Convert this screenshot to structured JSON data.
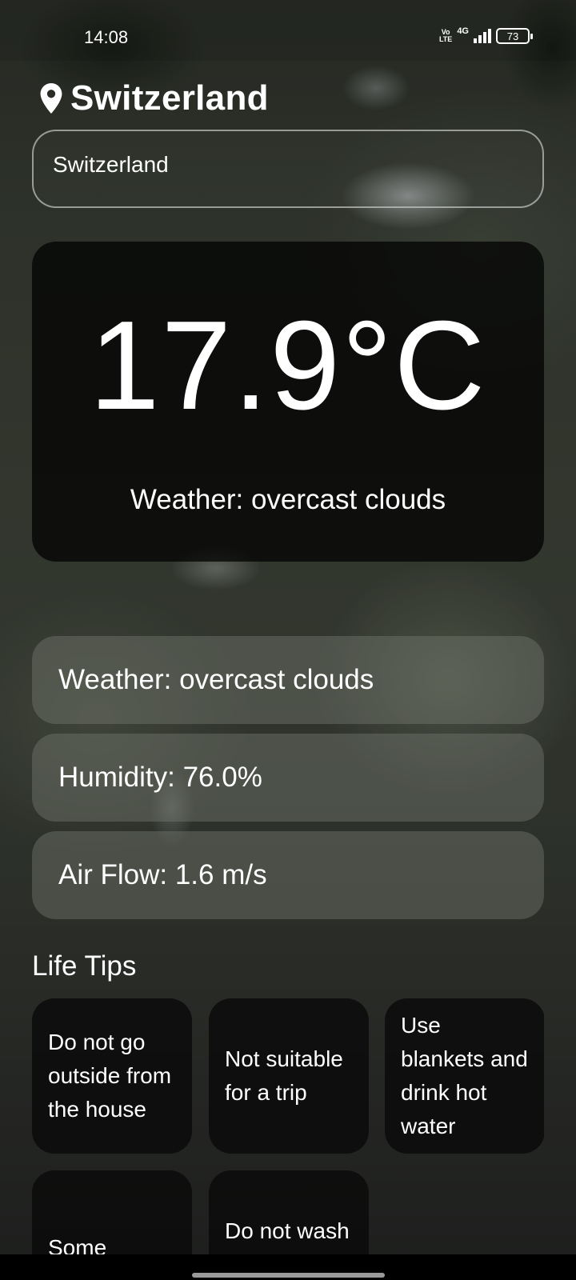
{
  "status_bar": {
    "time": "14:08",
    "volte_top": "Vo",
    "volte_bottom": "LTE",
    "network": "4G",
    "battery": "73"
  },
  "header": {
    "location_icon": "location-pin-icon",
    "title": "Switzerland"
  },
  "search": {
    "value": "Switzerland"
  },
  "current": {
    "temperature": "17.9°C",
    "description": "Weather: overcast clouds"
  },
  "details": [
    {
      "label": "Weather: overcast clouds"
    },
    {
      "label": "Humidity: 76.0%"
    },
    {
      "label": "Air Flow: 1.6 m/s"
    }
  ],
  "tips": {
    "title": "Life Tips",
    "items": [
      "Do not go outside from the house",
      "Not suitable for a trip",
      "Use blankets and drink hot water",
      "Some",
      "Do not wash your"
    ]
  },
  "colors": {
    "card_dark": "#0b0b0b",
    "card_light": "#787d73",
    "text": "#ffffff"
  }
}
